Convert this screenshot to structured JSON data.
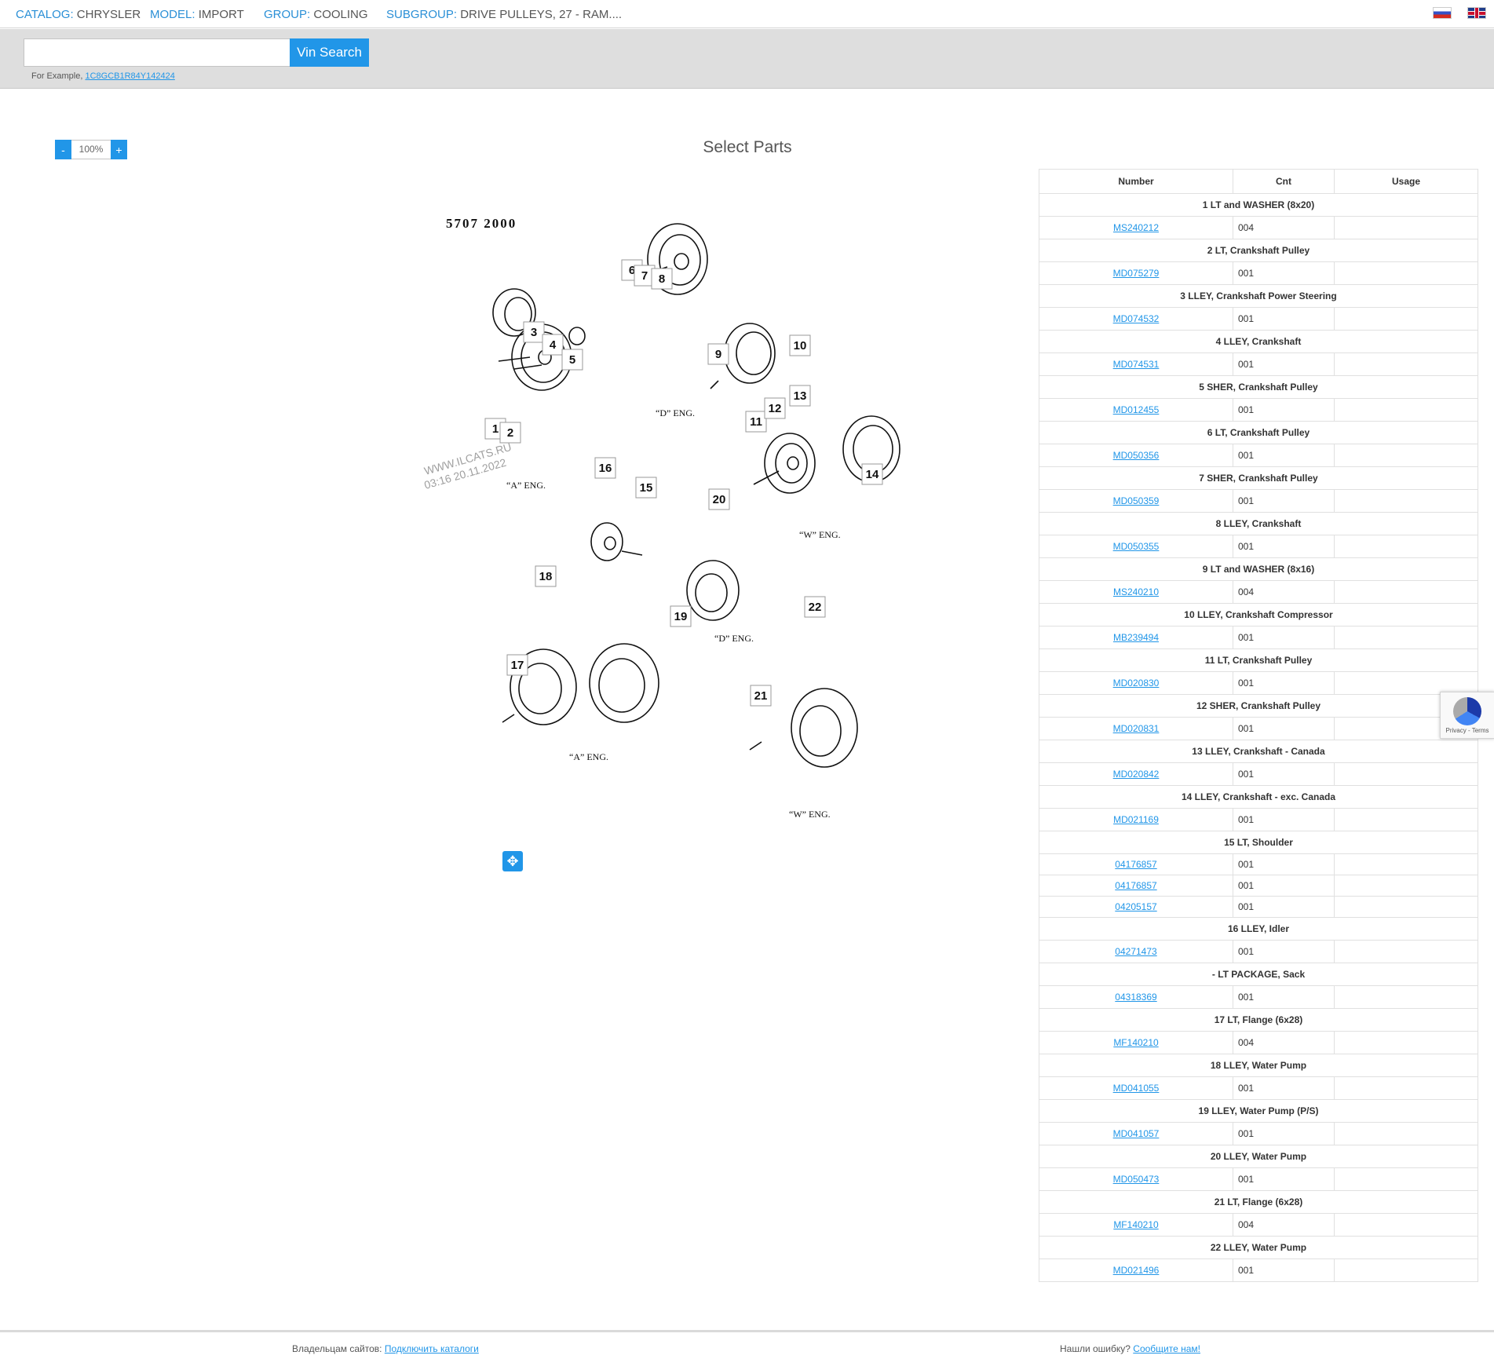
{
  "breadcrumb": {
    "catalog_key": "CATALOG:",
    "catalog_val": "CHRYSLER",
    "model_key": "MODEL:",
    "model_val": "IMPORT",
    "group_key": "GROUP:",
    "group_val": "COOLING",
    "subgroup_key": "SUBGROUP:",
    "subgroup_val": "DRIVE PULLEYS, 27 - RAM...."
  },
  "vin": {
    "placeholder": "",
    "button_label": "Vin Search",
    "example_prefix": "For Example,",
    "example_value": "1C8GCB1R84Y142424"
  },
  "zoom": {
    "minus": "-",
    "value": "100%",
    "plus": "+"
  },
  "page_title": "Select Parts",
  "diagram": {
    "code": "5707  2000",
    "watermark_line1": "WWW.ILCATS.RU",
    "watermark_line2": "03:16 20.11.2022",
    "captions": {
      "a1": "“A” ENG.",
      "d1": "“D” ENG.",
      "w1": "“W” ENG.",
      "d2": "“D” ENG.",
      "a2": "“A” ENG.",
      "w2": "“W” ENG."
    },
    "callouts": [
      "1",
      "2",
      "3",
      "4",
      "5",
      "6",
      "7",
      "8",
      "9",
      "10",
      "11",
      "12",
      "13",
      "14",
      "15",
      "16",
      "17",
      "18",
      "19",
      "20",
      "21",
      "22"
    ]
  },
  "table": {
    "headers": [
      "Number",
      "Cnt",
      "Usage"
    ],
    "groups": [
      {
        "title": "1 LT and WASHER (8x20)",
        "rows": [
          [
            "MS240212",
            "004"
          ]
        ]
      },
      {
        "title": "2 LT, Crankshaft Pulley",
        "rows": [
          [
            "MD075279",
            "001"
          ]
        ]
      },
      {
        "title": "3 LLEY, Crankshaft Power Steering",
        "rows": [
          [
            "MD074532",
            "001"
          ]
        ]
      },
      {
        "title": "4 LLEY, Crankshaft",
        "rows": [
          [
            "MD074531",
            "001"
          ]
        ]
      },
      {
        "title": "5 SHER, Crankshaft Pulley",
        "rows": [
          [
            "MD012455",
            "001"
          ]
        ]
      },
      {
        "title": "6 LT, Crankshaft Pulley",
        "rows": [
          [
            "MD050356",
            "001"
          ]
        ]
      },
      {
        "title": "7 SHER, Crankshaft Pulley",
        "rows": [
          [
            "MD050359",
            "001"
          ]
        ]
      },
      {
        "title": "8 LLEY, Crankshaft",
        "rows": [
          [
            "MD050355",
            "001"
          ]
        ]
      },
      {
        "title": "9 LT and WASHER (8x16)",
        "rows": [
          [
            "MS240210",
            "004"
          ]
        ]
      },
      {
        "title": "10 LLEY, Crankshaft Compressor",
        "rows": [
          [
            "MB239494",
            "001"
          ]
        ]
      },
      {
        "title": "11 LT, Crankshaft Pulley",
        "rows": [
          [
            "MD020830",
            "001"
          ]
        ]
      },
      {
        "title": "12 SHER, Crankshaft Pulley",
        "rows": [
          [
            "MD020831",
            "001"
          ]
        ]
      },
      {
        "title": "13 LLEY, Crankshaft - Canada",
        "rows": [
          [
            "MD020842",
            "001"
          ]
        ]
      },
      {
        "title": "14 LLEY, Crankshaft - exc. Canada",
        "rows": [
          [
            "MD021169",
            "001"
          ]
        ]
      },
      {
        "title": "15 LT, Shoulder",
        "rows": [
          [
            "04176857",
            "001"
          ],
          [
            "04176857",
            "001"
          ],
          [
            "04205157",
            "001"
          ]
        ]
      },
      {
        "title": "16 LLEY, Idler",
        "rows": [
          [
            "04271473",
            "001"
          ]
        ]
      },
      {
        "title": "- LT PACKAGE, Sack",
        "rows": [
          [
            "04318369",
            "001"
          ]
        ]
      },
      {
        "title": "17 LT, Flange (6x28)",
        "rows": [
          [
            "MF140210",
            "004"
          ]
        ]
      },
      {
        "title": "18 LLEY, Water Pump",
        "rows": [
          [
            "MD041055",
            "001"
          ]
        ]
      },
      {
        "title": "19 LLEY, Water Pump (P/S)",
        "rows": [
          [
            "MD041057",
            "001"
          ]
        ]
      },
      {
        "title": "20 LLEY, Water Pump",
        "rows": [
          [
            "MD050473",
            "001"
          ]
        ]
      },
      {
        "title": "21 LT, Flange (6x28)",
        "rows": [
          [
            "MF140210",
            "004"
          ]
        ]
      },
      {
        "title": "22 LLEY, Water Pump",
        "rows": [
          [
            "MD021496",
            "001"
          ]
        ]
      }
    ]
  },
  "recaptcha": {
    "text": "Privacy - Terms"
  },
  "footer": {
    "left_prefix": "Владельцам сайтов:",
    "left_link": "Подключить каталоги",
    "right_prefix": "Нашли ошибку?",
    "right_link": "Сообщите нам!"
  }
}
